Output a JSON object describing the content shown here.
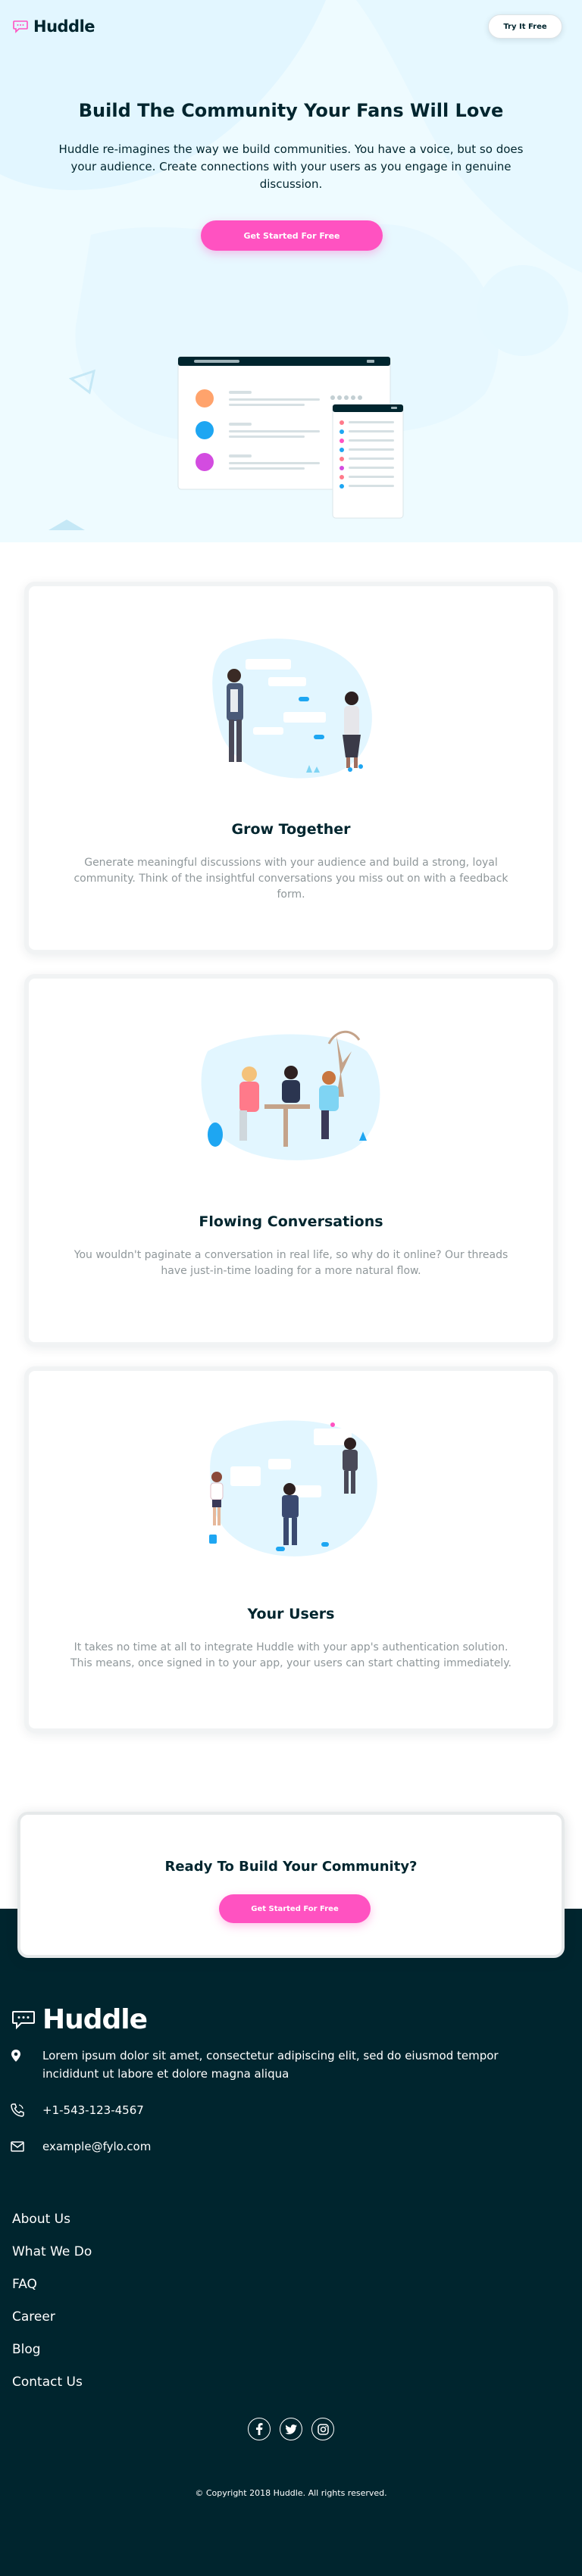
{
  "brand": {
    "name": "Huddle",
    "accent": "#ff52c1",
    "dark": "#00252e",
    "hero_bg": "#eefbff"
  },
  "header": {
    "cta_label": "Try It Free"
  },
  "hero": {
    "title": "Build The Community Your Fans Will Love",
    "description": "Huddle re-imagines the way we build communities. You have a voice, but so does your audience. Create connections with your users as you engage in genuine discussion.",
    "cta_label": "Get Started For Free"
  },
  "features": [
    {
      "title": "Grow Together",
      "description": "Generate meaningful discussions with your audience and build a strong, loyal community. Think of the insightful conversations you miss out on with a feedback form."
    },
    {
      "title": "Flowing Conversations",
      "description": "You wouldn't paginate a conversation in real life, so why do it online? Our threads have just-in-time loading for a more natural flow."
    },
    {
      "title": "Your Users",
      "description": "It takes no time at all to integrate Huddle with your app's authentication solution. This means, once signed in to your app, your users can start chatting immediately."
    }
  ],
  "cta_box": {
    "title": "Ready To Build Your Community?",
    "cta_label": "Get Started For Free"
  },
  "footer": {
    "logo": "Huddle",
    "address": "Lorem ipsum dolor sit amet, consectetur adipiscing elit, sed do eiusmod tempor incididunt ut labore et dolore magna aliqua",
    "phone": "+1-543-123-4567",
    "email": "example@fylo.com",
    "links": [
      "About Us",
      "What We Do",
      "FAQ",
      "Career",
      "Blog",
      "Contact Us"
    ],
    "socials": [
      "facebook-icon",
      "twitter-icon",
      "instagram-icon"
    ],
    "copyright": "© Copyright 2018 Huddle. All rights reserved."
  }
}
